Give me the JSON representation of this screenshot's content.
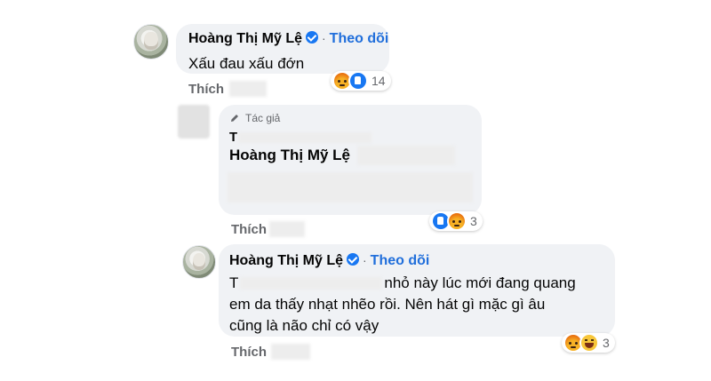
{
  "comments": [
    {
      "name": "Hoàng Thị Mỹ Lệ",
      "follow": "Theo dõi",
      "text": "Xấu đau xấu đớn",
      "action": "Thích",
      "reaction_count": "14",
      "reactions": [
        "angry-icon",
        "like-icon"
      ]
    },
    {
      "badge": "Tác giả",
      "partial_line": "T",
      "mention": "Hoàng Thị Mỹ Lệ",
      "action": "Thích",
      "reaction_count": "3",
      "reactions": [
        "like-icon",
        "angry-icon"
      ]
    },
    {
      "name": "Hoàng Thị Mỹ Lệ",
      "follow": "Theo dõi",
      "text_prefix": "T",
      "text_line1": "nhỏ này lúc mới đang quang",
      "text_line2": "em da thấy nhạt nhẽo rồi. Nên hát gì mặc gì âu",
      "text_line3": "cũng là não chỉ có vậy",
      "action": "Thích",
      "reaction_count": "3",
      "reactions": [
        "angry-icon",
        "haha-icon"
      ]
    }
  ],
  "colors": {
    "link": "#216fdb",
    "bubble": "#f0f2f5",
    "muted": "#65676b",
    "verified": "#1877f2"
  }
}
